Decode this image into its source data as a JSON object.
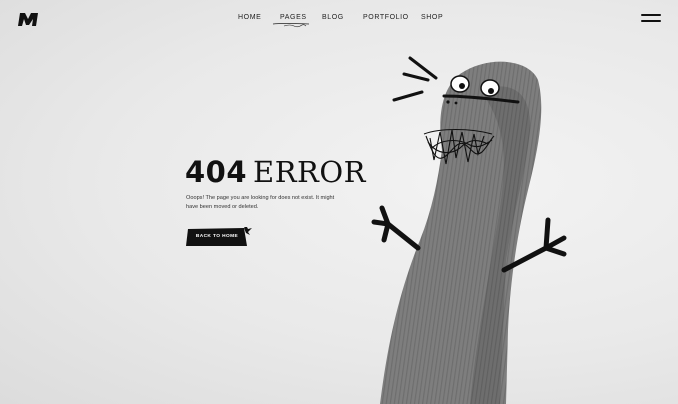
{
  "header": {
    "logo_icon": "brand-m-logo",
    "nav": [
      {
        "label": "HOME"
      },
      {
        "label": "PAGES",
        "active": true
      },
      {
        "label": "BLOG"
      },
      {
        "label": "PORTFOLIO"
      },
      {
        "label": "SHOP"
      }
    ],
    "menu_icon": "hamburger-menu-icon"
  },
  "main": {
    "error_code": "404",
    "error_word": "ERROR",
    "message": "Ooops! The page you are looking for does not exist. It might have been moved or deleted.",
    "back_button": "BACK TO HOME"
  },
  "colors": {
    "background": "#e9e9e9",
    "ink": "#111111",
    "sock": "#7d7d7d",
    "button": "#111111"
  }
}
